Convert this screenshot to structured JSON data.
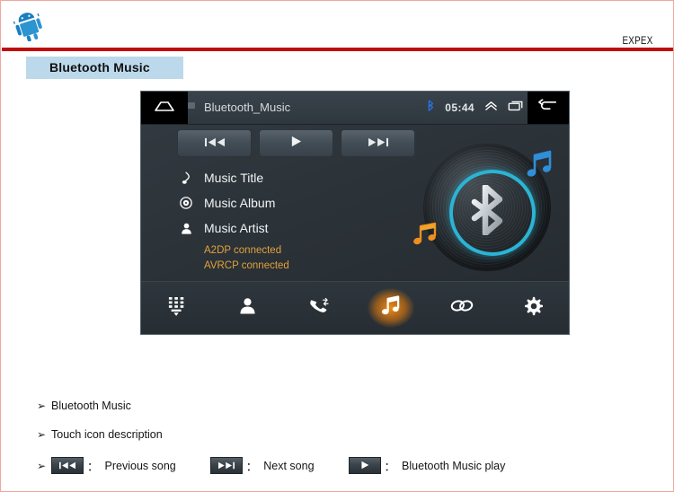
{
  "header": {
    "logo_icon": "android-robot-logo",
    "brand": "EXPEX"
  },
  "title_banner": {
    "text": "Bluetooth Music"
  },
  "device": {
    "statusbar": {
      "home_icon": "home-icon",
      "title": "Bluetooth_Music",
      "bluetooth_icon": "bluetooth-icon",
      "time": "05:44",
      "expand_icon": "chevron-double-up-icon",
      "recents_icon": "recent-apps-icon",
      "back_icon": "back-arrow-icon"
    },
    "transport": {
      "previous_icon": "previous-track-icon",
      "play_icon": "play-icon",
      "next_icon": "next-track-icon"
    },
    "meta": [
      {
        "icon": "music-note-icon",
        "label": "Music Title"
      },
      {
        "icon": "disc-icon",
        "label": "Music Album"
      },
      {
        "icon": "person-icon",
        "label": "Music Artist"
      }
    ],
    "status_lines": [
      "A2DP connected",
      "AVRCP connected"
    ],
    "artwork": {
      "vinyl_icon": "vinyl-record-icon",
      "bluetooth_icon": "bluetooth-logo-icon",
      "note_blue_icon": "music-note-blue-icon",
      "note_orange_icon": "music-note-orange-icon",
      "ring_color": "#2bb4d4"
    },
    "navbar": [
      {
        "icon": "dialpad-icon",
        "name": "nav-dialpad",
        "active": false
      },
      {
        "icon": "contacts-icon",
        "name": "nav-contacts",
        "active": false
      },
      {
        "icon": "call-history-icon",
        "name": "nav-call-history",
        "active": false
      },
      {
        "icon": "music-icon",
        "name": "nav-music",
        "active": true
      },
      {
        "icon": "link-icon",
        "name": "nav-paired-devices",
        "active": false
      },
      {
        "icon": "settings-gear-icon",
        "name": "nav-settings",
        "active": false
      }
    ]
  },
  "notes": {
    "bullet": "➢",
    "line1": "Bluetooth Music",
    "line2": "Touch icon description",
    "legend": [
      {
        "icon": "previous-track-icon",
        "colon": "：",
        "label": "Previous song"
      },
      {
        "icon": "next-track-icon",
        "colon": "：",
        "label": "Next song"
      },
      {
        "icon": "play-icon",
        "colon": "：",
        "label": "Bluetooth Music play"
      }
    ]
  },
  "colors": {
    "brand_red": "#c00d0d",
    "banner_blue": "#bcd9ec",
    "status_orange": "#e2a23a",
    "accent_cyan": "#2bb4d4"
  }
}
